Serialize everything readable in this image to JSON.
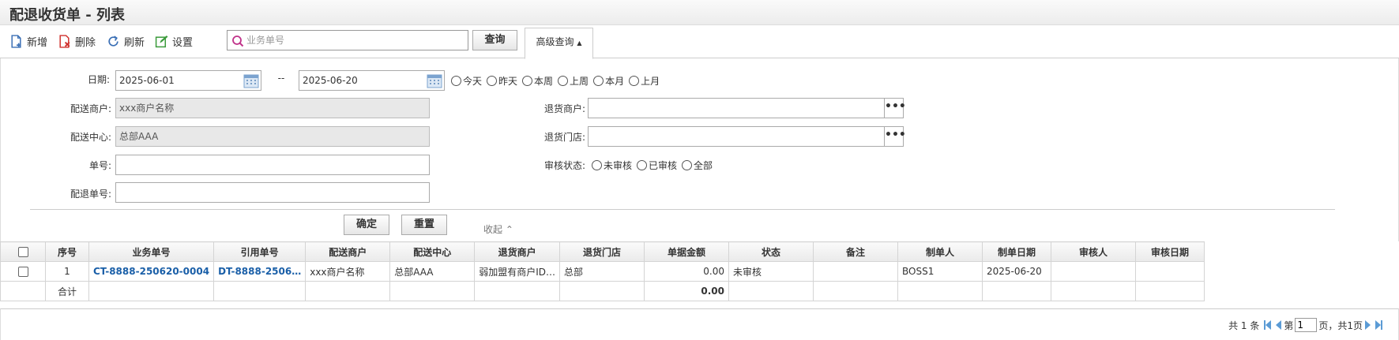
{
  "page": {
    "title": "配退收货单 - 列表"
  },
  "toolbar": {
    "add_label": "新增",
    "delete_label": "删除",
    "refresh_label": "刷新",
    "settings_label": "设置",
    "search_placeholder": "业务单号",
    "query_label": "查询",
    "advanced_label": "高级查询"
  },
  "filters": {
    "date_label": "日期:",
    "date_from": "2025-06-01",
    "date_sep": "--",
    "date_to": "2025-06-20",
    "date_quick": [
      "今天",
      "昨天",
      "本周",
      "上周",
      "本月",
      "上月"
    ],
    "merchant_label": "配送商户:",
    "merchant_value": "xxx商户名称",
    "center_label": "配送中心:",
    "center_value": "总部AAA",
    "order_no_label": "单号:",
    "order_no_value": "",
    "return_no_label": "配退单号:",
    "return_no_value": "",
    "return_merchant_label": "退货商户:",
    "return_merchant_value": "",
    "return_store_label": "退货门店:",
    "return_store_value": "",
    "audit_label": "审核状态:",
    "audit_options": [
      "未审核",
      "已审核",
      "全部"
    ],
    "dots": "•••",
    "confirm_label": "确定",
    "reset_label": "重置",
    "collapse_label": "收起 ⌃"
  },
  "table": {
    "columns": [
      "序号",
      "业务单号",
      "引用单号",
      "配送商户",
      "配送中心",
      "退货商户",
      "退货门店",
      "单据金额",
      "状态",
      "备注",
      "制单人",
      "制单日期",
      "审核人",
      "审核日期"
    ],
    "rows": [
      {
        "seq": "1",
        "biz_no": "CT-8888-250620-0004",
        "ref_no": "DT-8888-2506…",
        "merchant": "xxx商户名称",
        "center": "总部AAA",
        "return_merchant": "弱加盟有商户ID…",
        "return_store": "总部",
        "amount": "0.00",
        "status": "未审核",
        "remark": "",
        "creator": "BOSS1",
        "create_date": "2025-06-20",
        "auditor": "",
        "audit_date": ""
      }
    ],
    "total_label": "合计",
    "total_amount": "0.00"
  },
  "pager": {
    "total_text": "共 1 条",
    "page_prefix": "第",
    "page_value": "1",
    "page_suffix": "页，共1页"
  },
  "colors": {
    "link": "#1a5fa8",
    "pager_nav": "#5b9bd5",
    "add_icon": "#3a6fb5",
    "delete_icon": "#d0312d",
    "settings_icon": "#3a9a3a"
  }
}
